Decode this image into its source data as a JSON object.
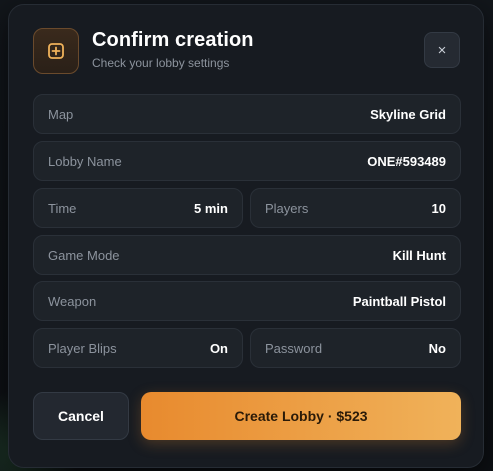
{
  "header": {
    "title": "Confirm creation",
    "subtitle": "Check your lobby settings",
    "icon": "plus-square-icon",
    "close_icon": "close-icon",
    "close_label": "×"
  },
  "settings": {
    "map": {
      "label": "Map",
      "value": "Skyline Grid"
    },
    "lobby_name": {
      "label": "Lobby Name",
      "value": "ONE#593489"
    },
    "time": {
      "label": "Time",
      "value": "5 min"
    },
    "players": {
      "label": "Players",
      "value": "10"
    },
    "game_mode": {
      "label": "Game Mode",
      "value": "Kill Hunt"
    },
    "weapon": {
      "label": "Weapon",
      "value": "Paintball Pistol"
    },
    "player_blips": {
      "label": "Player Blips",
      "value": "On"
    },
    "password": {
      "label": "Password",
      "value": "No"
    }
  },
  "actions": {
    "cancel_label": "Cancel",
    "create_label": "Create Lobby · $523"
  },
  "colors": {
    "accent_start": "#e88a2e",
    "accent_end": "#f0b25a",
    "panel": "#171b21",
    "row": "#1e2329"
  }
}
